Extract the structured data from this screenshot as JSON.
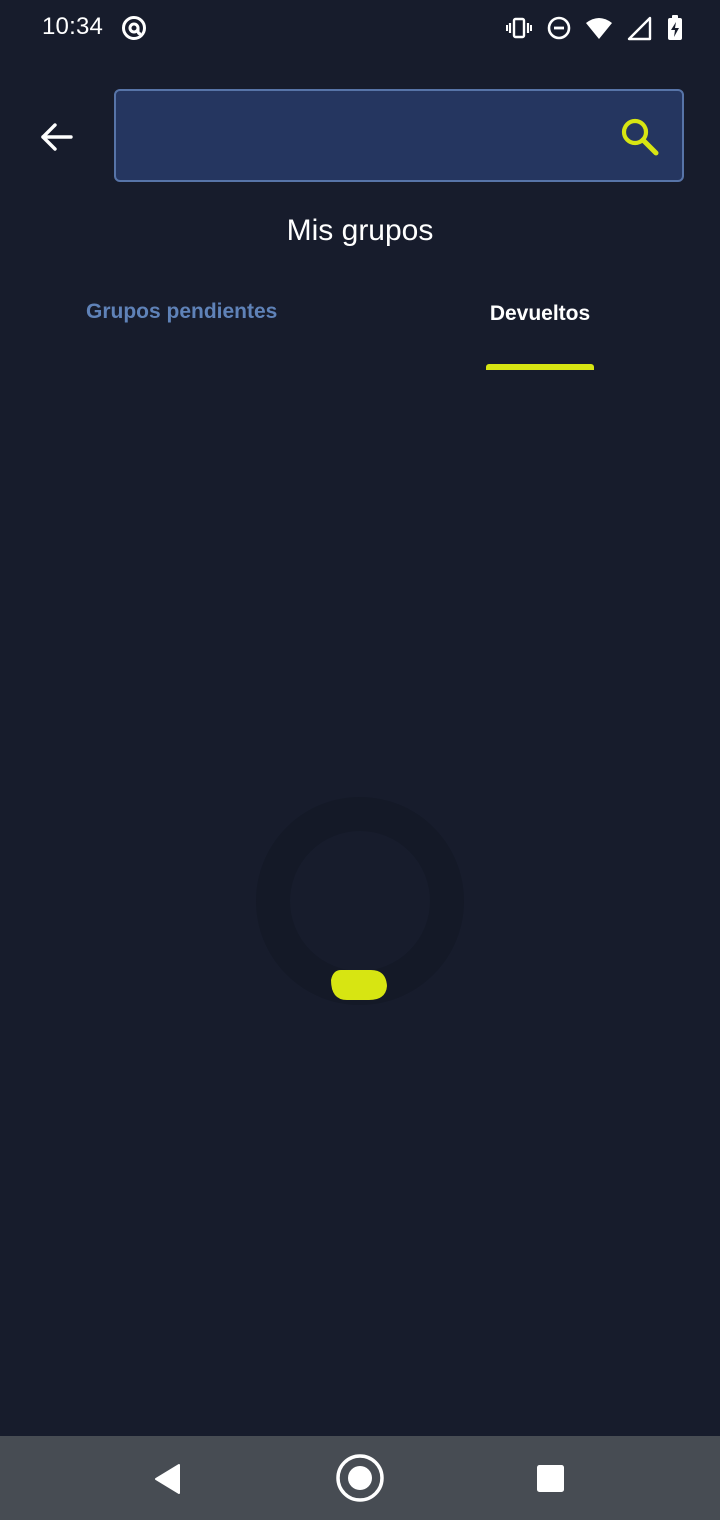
{
  "status_bar": {
    "time": "10:34",
    "left_icons": [
      "at-sign-icon"
    ],
    "right_icons": [
      "vibrate-icon",
      "do-not-disturb-icon",
      "wifi-icon",
      "cell-signal-icon",
      "battery-charging-icon"
    ]
  },
  "header": {
    "back_icon": "arrow-left-icon",
    "search": {
      "value": "",
      "placeholder": "",
      "icon": "search-icon"
    }
  },
  "page": {
    "title": "Mis grupos"
  },
  "tabs": [
    {
      "label": "Grupos pendientes",
      "selected": false
    },
    {
      "label": "Devueltos",
      "selected": true
    }
  ],
  "loading": {
    "icon": "loading-spinner"
  },
  "nav_bar": {
    "buttons": [
      "back-triangle-icon",
      "home-circle-icon",
      "recents-square-icon"
    ]
  },
  "colors": {
    "background": "#171c2c",
    "search_background": "#253660",
    "search_border": "#5774a8",
    "accent": "#d7e512",
    "inactive_tab": "#5f82b8",
    "nav_bar": "#474c53"
  }
}
